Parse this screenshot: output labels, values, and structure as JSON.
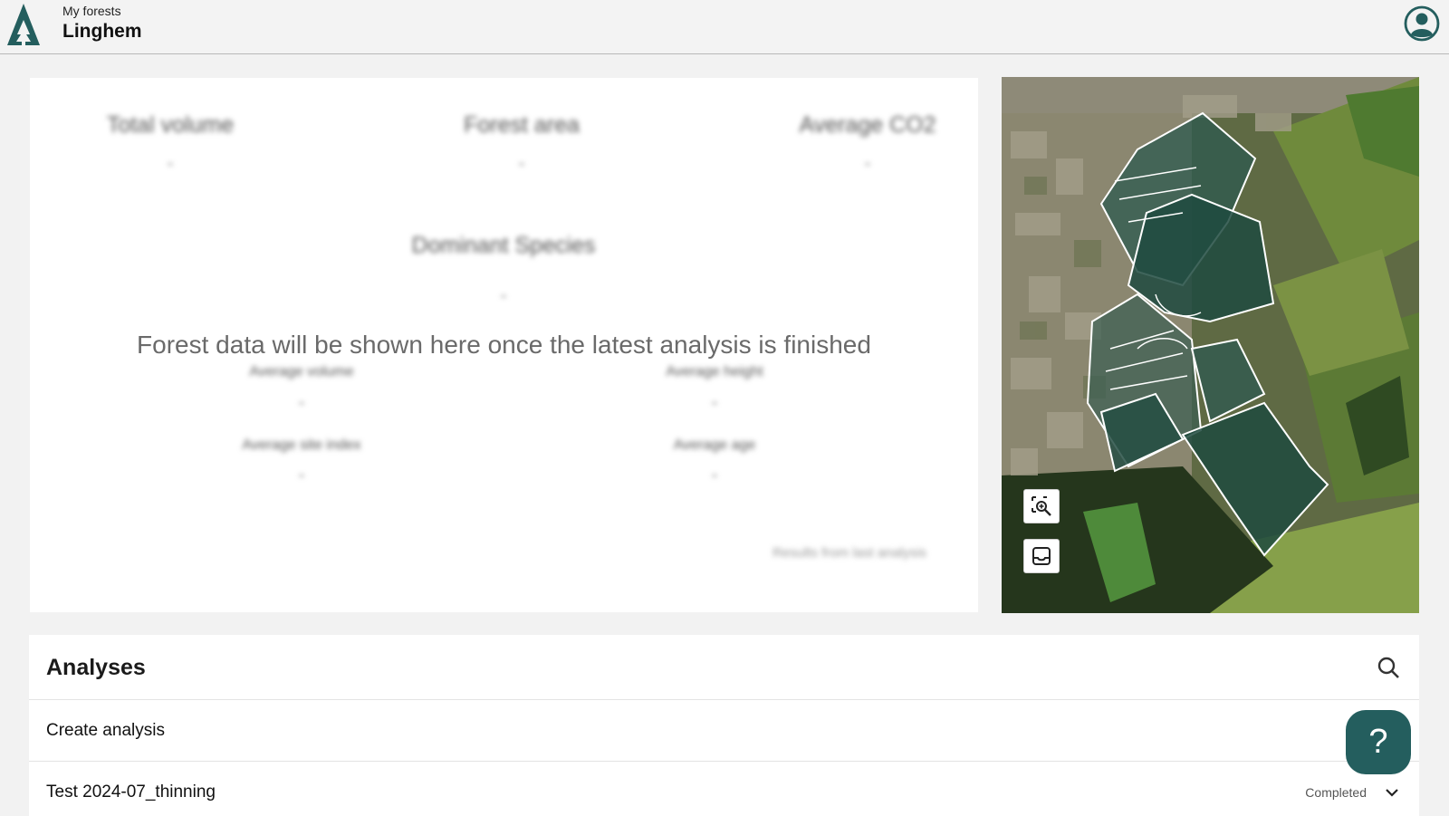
{
  "header": {
    "breadcrumb_parent": "My forests",
    "forest_name": "Linghem",
    "logo_icon": "tree-logo-icon",
    "account_icon": "user-account-icon"
  },
  "summary": {
    "stats_top": [
      {
        "label": "Total volume",
        "value": "-"
      },
      {
        "label": "Forest area",
        "value": "-"
      },
      {
        "label": "Average CO2",
        "value": "-"
      }
    ],
    "dominant_species": {
      "label": "Dominant Species",
      "value": "-"
    },
    "pending_message": "Forest data will be shown here once the latest analysis is finished",
    "stats_grid": [
      {
        "label": "Average volume",
        "value": "-"
      },
      {
        "label": "Average height",
        "value": "-"
      },
      {
        "label": "Average site index",
        "value": "-"
      },
      {
        "label": "Average age",
        "value": "-"
      }
    ],
    "footer_note": "Results from last analysis"
  },
  "map": {
    "tools": [
      "zoom-to-area-icon",
      "inbox-icon"
    ]
  },
  "analyses": {
    "title": "Analyses",
    "create_label": "Create analysis",
    "items": [
      {
        "name": "Test 2024-07_thinning",
        "status": "Completed"
      }
    ]
  },
  "help": {
    "label": "?"
  },
  "colors": {
    "brand": "#245e5e",
    "background": "#f2f2f2"
  }
}
